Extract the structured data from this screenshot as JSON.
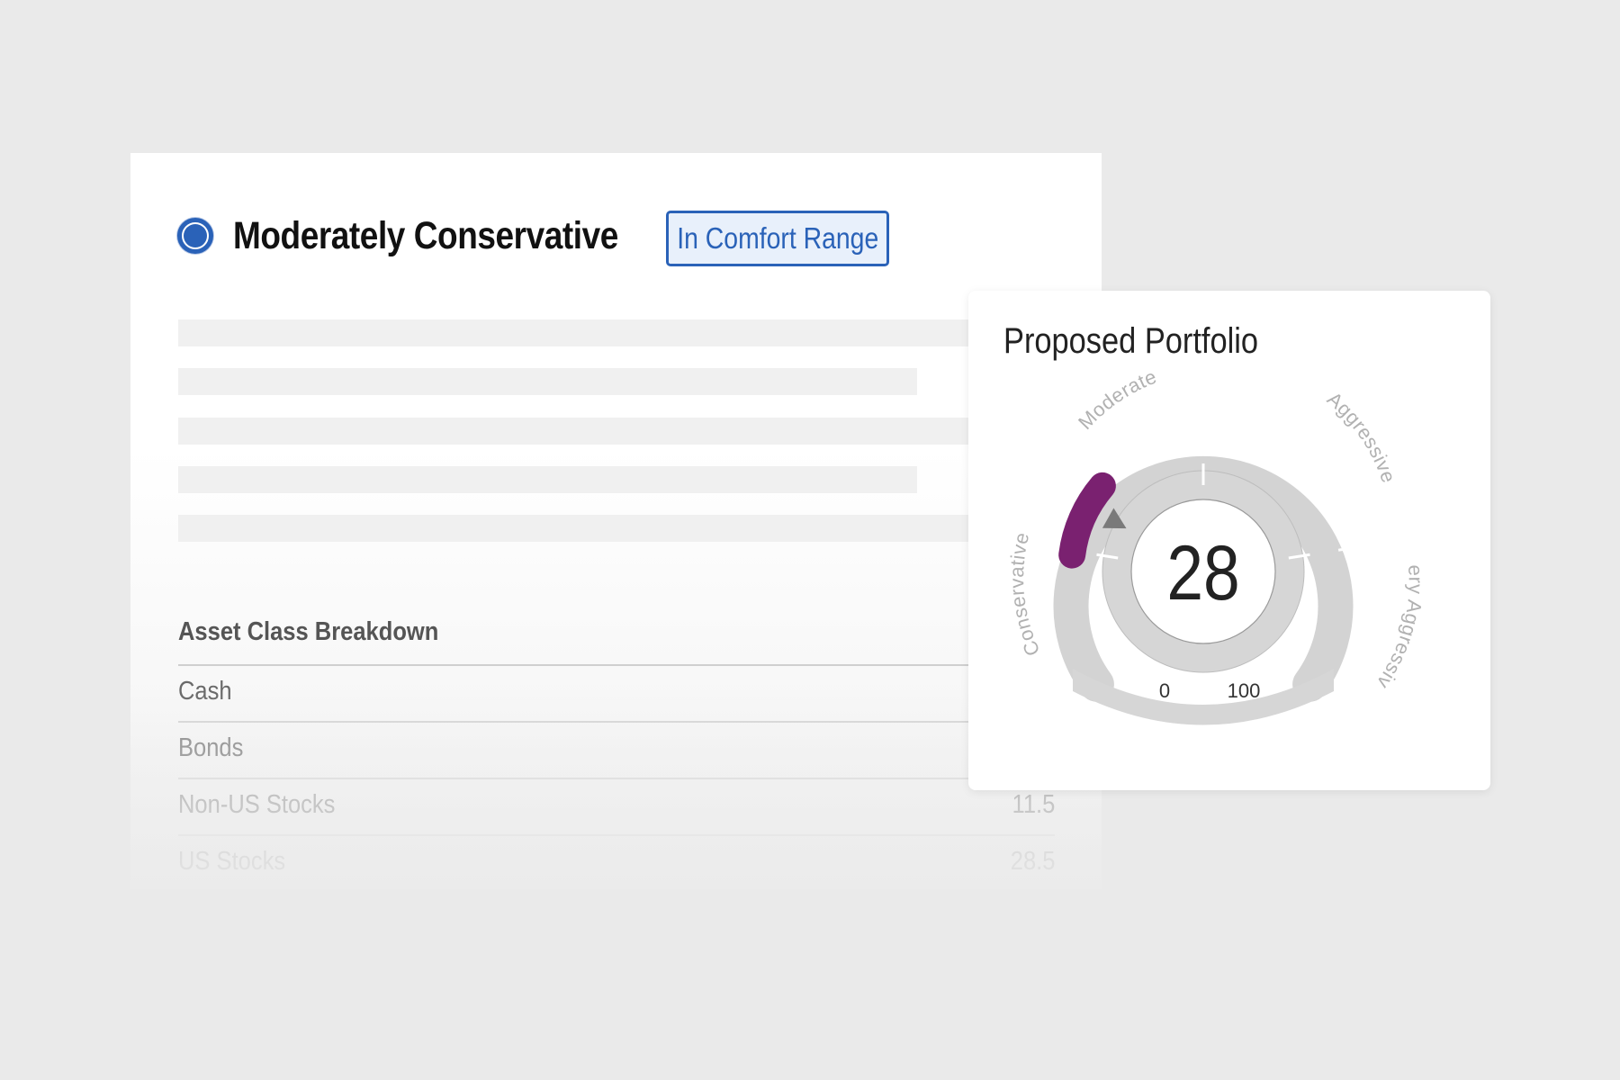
{
  "profile": {
    "risk_level": "Moderately Conservative",
    "badge": "In Comfort Range",
    "radio_color": "#2a62b8"
  },
  "asset_breakdown": {
    "title": "Asset Class Breakdown",
    "rows": [
      {
        "label": "Cash",
        "value": ""
      },
      {
        "label": "Bonds",
        "value": ""
      },
      {
        "label": "Non-US Stocks",
        "value": "11.5"
      },
      {
        "label": "US Stocks",
        "value": "28.5"
      }
    ]
  },
  "portfolio": {
    "title": "Proposed Portfolio",
    "score": "28",
    "score_value": 28,
    "scale_min": "0",
    "scale_max": "100",
    "zones": [
      "Conservative",
      "Moderate",
      "Aggressive",
      "Very Aggressive"
    ],
    "comfort_range": [
      20,
      32
    ],
    "highlight_color": "#7a2170"
  }
}
